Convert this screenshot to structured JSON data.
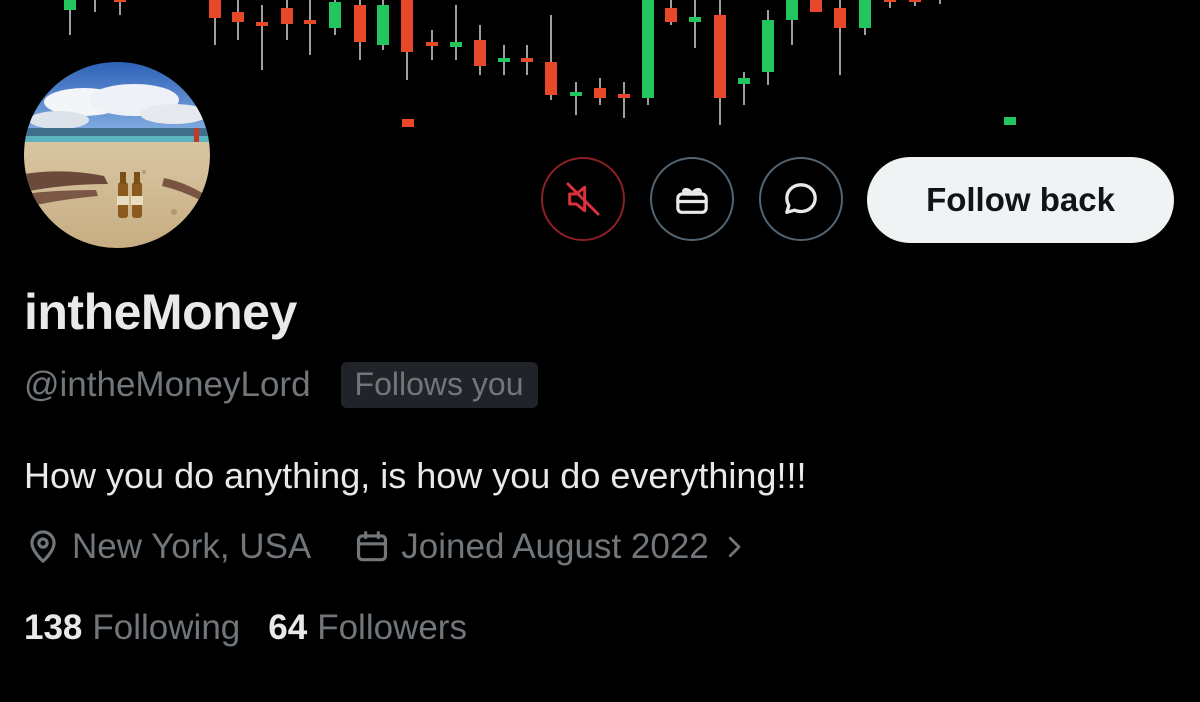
{
  "profile": {
    "display_name": "intheMoney",
    "handle": "@intheMoneyLord",
    "follows_you_badge": "Follows you",
    "bio": "How you do anything, is how you do everything!!!",
    "location": "New York, USA",
    "joined": "Joined August 2022",
    "following_count": "138",
    "following_label": "Following",
    "followers_count": "64",
    "followers_label": "Followers"
  },
  "actions": {
    "follow_back_label": "Follow back",
    "icons": [
      "muted-icon",
      "gift-icon",
      "message-icon"
    ]
  },
  "banner": {
    "description_icon": "candlestick-chart",
    "colors": {
      "up": "#22c55e",
      "down": "#e8482a",
      "wick": "#9aa0a6"
    }
  },
  "theme": {
    "background": "#000000",
    "text_primary": "#e7e9ea",
    "text_secondary": "#71767b",
    "muted_accent": "#d9323a"
  }
}
